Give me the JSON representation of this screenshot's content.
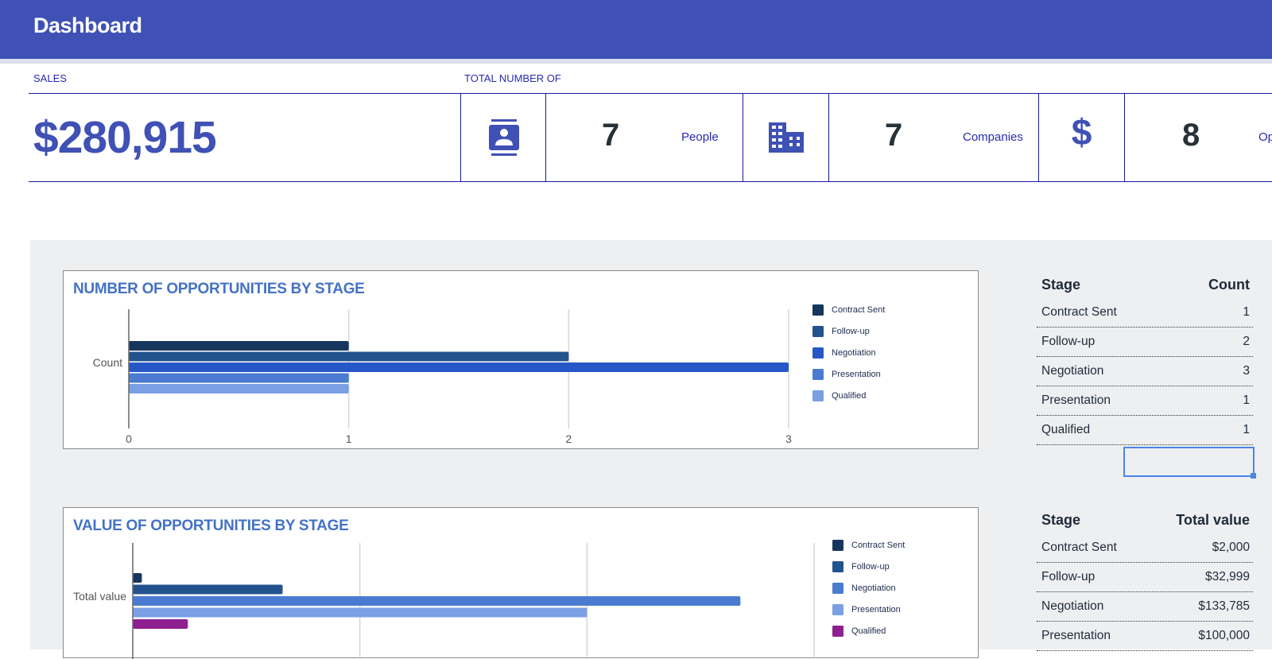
{
  "header": {
    "title": "Dashboard"
  },
  "sales": {
    "label": "SALES",
    "value": "$280,915"
  },
  "totals": {
    "label": "TOTAL NUMBER OF",
    "items": [
      {
        "icon": "contact-card-icon",
        "count": "7",
        "label": "People"
      },
      {
        "icon": "building-icon",
        "count": "7",
        "label": "Companies"
      },
      {
        "icon": "dollar-icon",
        "count": "8",
        "label": "Opportunities",
        "visible_label": "Op"
      }
    ]
  },
  "charts": {
    "count_chart": {
      "title": "NUMBER OF OPPORTUNITIES BY STAGE"
    },
    "value_chart": {
      "title": "VALUE OF OPPORTUNITIES BY STAGE"
    }
  },
  "chart_data": [
    {
      "type": "bar",
      "orientation": "horizontal",
      "title": "NUMBER OF OPPORTUNITIES BY STAGE",
      "categories": [
        "Count"
      ],
      "ylabel": "Count",
      "xlim": [
        0,
        3
      ],
      "xticks": [
        "0",
        "1",
        "2",
        "3"
      ],
      "grid": true,
      "legend": "right",
      "series": [
        {
          "name": "Contract Sent",
          "values": [
            1
          ],
          "color": "#17365d"
        },
        {
          "name": "Follow-up",
          "values": [
            2
          ],
          "color": "#23538e"
        },
        {
          "name": "Negotiation",
          "values": [
            3
          ],
          "color": "#2757c7"
        },
        {
          "name": "Presentation",
          "values": [
            1
          ],
          "color": "#4a7bd0"
        },
        {
          "name": "Qualified",
          "values": [
            1
          ],
          "color": "#7a9fe3"
        }
      ]
    },
    {
      "type": "bar",
      "orientation": "horizontal",
      "title": "VALUE OF OPPORTUNITIES BY STAGE",
      "categories": [
        "Total value"
      ],
      "ylabel": "Total value",
      "xlim": [
        0,
        150000
      ],
      "grid": true,
      "legend": "right",
      "series": [
        {
          "name": "Contract Sent",
          "values": [
            2000
          ],
          "color": "#17365d"
        },
        {
          "name": "Follow-up",
          "values": [
            32999
          ],
          "color": "#23538e"
        },
        {
          "name": "Negotiation",
          "values": [
            133785
          ],
          "color": "#4a7bd0"
        },
        {
          "name": "Presentation",
          "values": [
            100000
          ],
          "color": "#7a9fe3"
        },
        {
          "name": "Qualified",
          "values": [
            12131
          ],
          "color": "#8e1f91"
        }
      ]
    }
  ],
  "tables": {
    "count_table": {
      "headers": [
        "Stage",
        "Count"
      ],
      "rows": [
        [
          "Contract Sent",
          "1"
        ],
        [
          "Follow-up",
          "2"
        ],
        [
          "Negotiation",
          "3"
        ],
        [
          "Presentation",
          "1"
        ],
        [
          "Qualified",
          "1"
        ]
      ]
    },
    "value_table": {
      "headers": [
        "Stage",
        "Total value"
      ],
      "rows": [
        [
          "Contract Sent",
          "$2,000"
        ],
        [
          "Follow-up",
          "$32,999"
        ],
        [
          "Negotiation",
          "$133,785"
        ],
        [
          "Presentation",
          "$100,000"
        ]
      ]
    }
  }
}
